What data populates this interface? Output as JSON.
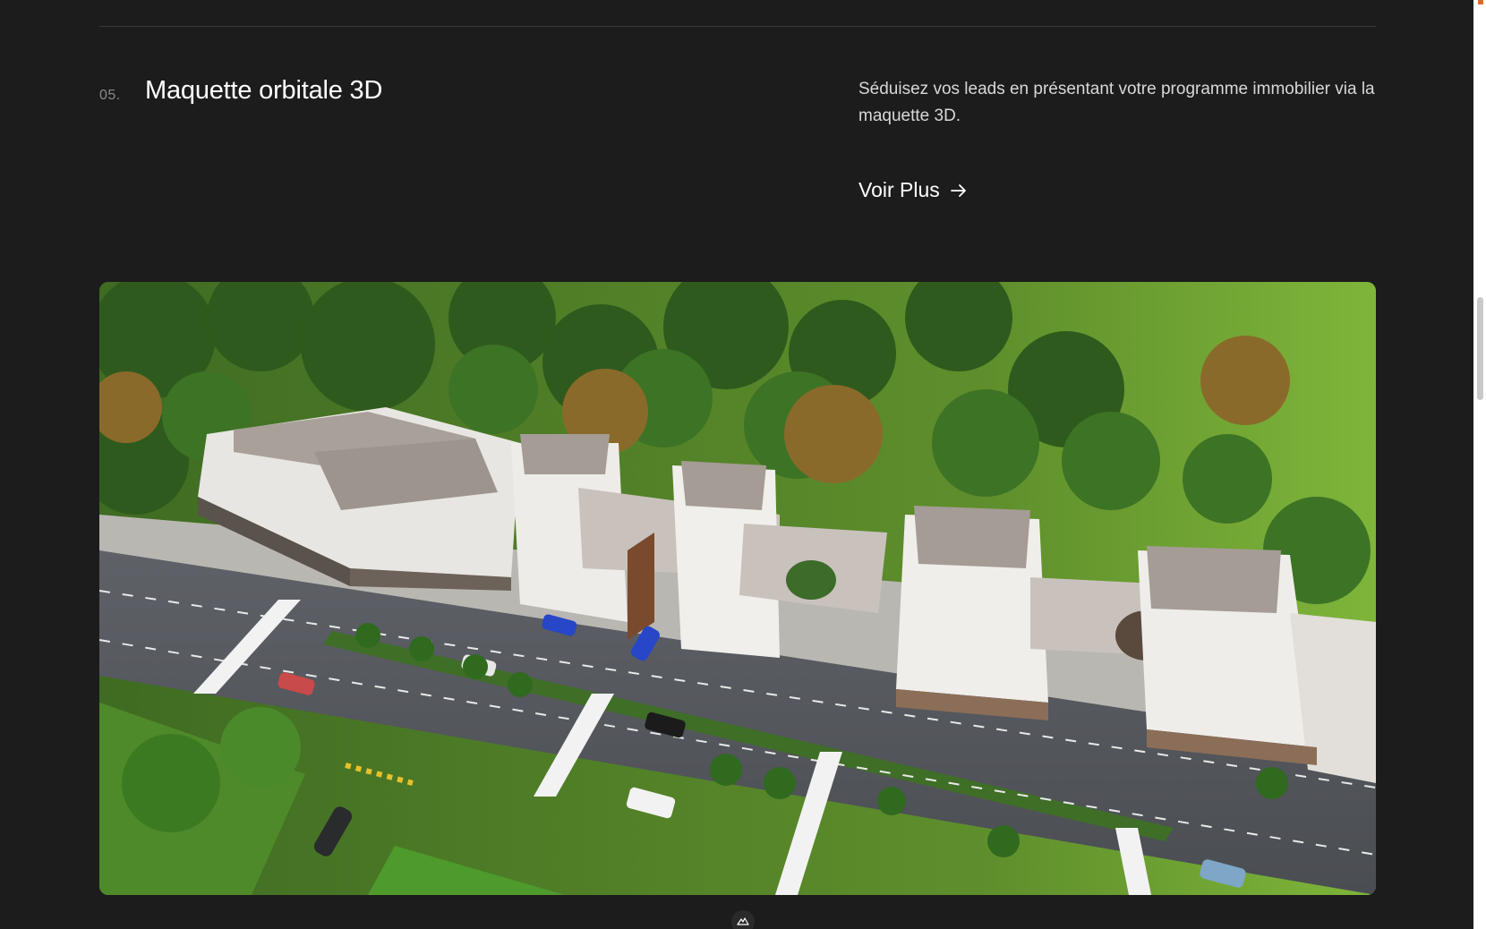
{
  "section": {
    "number": "05.",
    "title": "Maquette orbitale 3D",
    "description": "Séduisez vos leads en présentant votre programme immobilier via la maquette 3D.",
    "cta_label": "Voir Plus"
  },
  "hero_image": {
    "subject": "aerial-render-apartment-buildings"
  },
  "icons": {
    "cta": "arrow-right-icon",
    "badge": "mountain-logo-icon"
  },
  "colors": {
    "background": "#1c1c1c",
    "text": "#ffffff",
    "muted": "#8a8a8a",
    "divider": "#3a3a3a"
  }
}
